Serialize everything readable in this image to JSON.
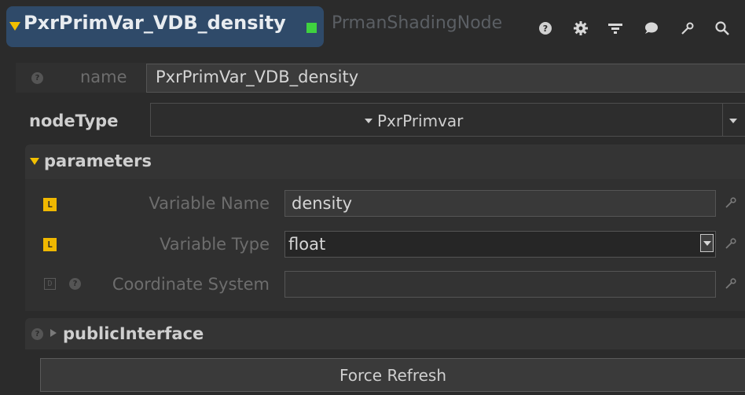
{
  "header": {
    "node_name": "PxrPrimVar_VDB_density",
    "node_type": "PrmanShadingNode",
    "icons": [
      "help-icon",
      "gear-icon",
      "wiring-icon",
      "comment-icon",
      "wrench-icon",
      "search-icon"
    ]
  },
  "name_row": {
    "label": "name",
    "value": "PxrPrimVar_VDB_density"
  },
  "node_type_row": {
    "label": "nodeType",
    "value": "PxrPrimvar"
  },
  "parameters": {
    "title": "parameters",
    "rows": [
      {
        "badge": "L",
        "label": "Variable Name",
        "value": "density"
      },
      {
        "badge": "L",
        "label": "Variable Type",
        "value": "float"
      },
      {
        "badge": "D",
        "label": "Coordinate System",
        "value": ""
      }
    ]
  },
  "public_interface": {
    "title": "publicInterface"
  },
  "force_refresh_label": "Force Refresh",
  "colors": {
    "accent_yellow": "#f2c000",
    "title_pill": "#2f4a69",
    "status_green": "#3fd13f",
    "background": "#2b2b2b"
  }
}
